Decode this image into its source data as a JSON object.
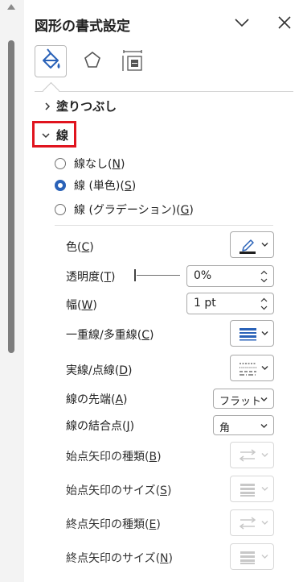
{
  "panel": {
    "title": "図形の書式設定",
    "collapse_icon": "chevron-down-icon",
    "close_icon": "close-icon"
  },
  "tabs": [
    {
      "name": "塗りつぶしと線",
      "icon": "paint-bucket-icon",
      "selected": true
    },
    {
      "name": "効果",
      "icon": "pentagon-icon",
      "selected": false
    },
    {
      "name": "サイズとプロパティ",
      "icon": "size-properties-icon",
      "selected": false
    }
  ],
  "sections": {
    "fill": {
      "label": "塗りつぶし",
      "expanded": false
    },
    "line": {
      "label": "線",
      "expanded": true,
      "highlight_color": "#e0141e"
    }
  },
  "line_type": {
    "options": [
      {
        "pre": "線なし(",
        "key": "N",
        "post": ")",
        "selected": false
      },
      {
        "pre": "線 (単色)(",
        "key": "S",
        "post": ")",
        "selected": true
      },
      {
        "pre": "線 (グラデーション)(",
        "key": "G",
        "post": ")",
        "selected": false
      }
    ]
  },
  "props": {
    "color": {
      "pre": "色(",
      "key": "C",
      "post": ")",
      "swatch": "#1f1f1f"
    },
    "transparency": {
      "pre": "透明度(",
      "key": "T",
      "post": ")",
      "value": "0%",
      "level": 0
    },
    "width": {
      "pre": "幅(",
      "key": "W",
      "post": ")",
      "value": "1 pt"
    },
    "compound": {
      "pre": "一重線/多重線(",
      "key": "C",
      "post": ")"
    },
    "dash": {
      "pre": "実線/点線(",
      "key": "D",
      "post": ")"
    },
    "cap": {
      "pre": "線の先端(",
      "key": "A",
      "post": ")",
      "value": "フラット"
    },
    "join": {
      "pre": "線の結合点(",
      "key": "J",
      "post": ")",
      "value": "角"
    },
    "begin_arrow_type": {
      "pre": "始点矢印の種類(",
      "key": "B",
      "post": ")",
      "enabled": false
    },
    "begin_arrow_size": {
      "pre": "始点矢印のサイズ(",
      "key": "S",
      "post": ")",
      "enabled": false
    },
    "end_arrow_type": {
      "pre": "終点矢印の種類(",
      "key": "E",
      "post": ")",
      "enabled": false
    },
    "end_arrow_size": {
      "pre": "終点矢印のサイズ(",
      "key": "N",
      "post": ")",
      "enabled": false
    }
  },
  "colors": {
    "accent": "#2a62b8",
    "highlight": "#e0141e"
  }
}
